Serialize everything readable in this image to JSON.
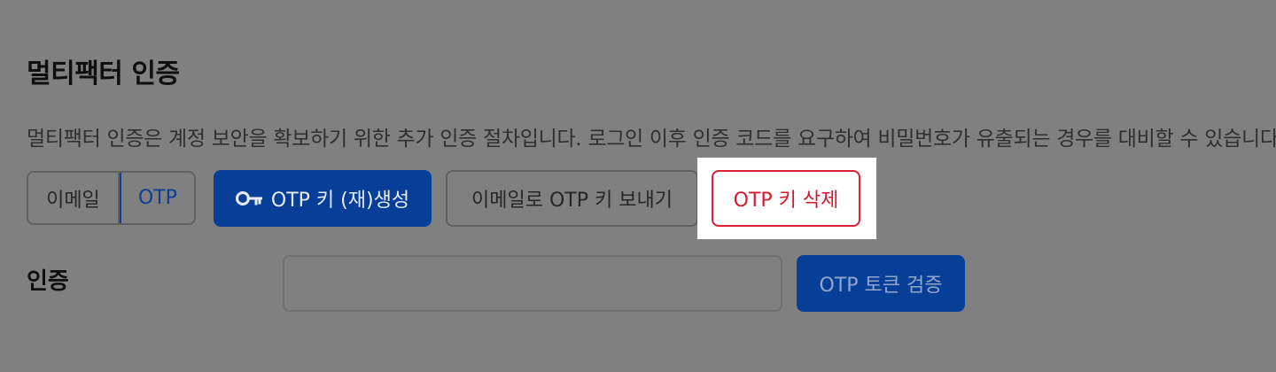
{
  "section": {
    "title": "멀티팩터 인증",
    "description": "멀티팩터 인증은 계정 보안을 확보하기 위한 추가 인증 절차입니다. 로그인 이후 인증 코드를 요구하여 비밀번호가 유출되는 경우를 대비할 수 있습니다."
  },
  "method_toggle": {
    "email_label": "이메일",
    "otp_label": "OTP",
    "selected": "OTP"
  },
  "actions": {
    "regenerate_label": "OTP 키 (재)생성",
    "regenerate_icon": "key-icon",
    "send_email_label": "이메일로 OTP 키 보내기",
    "delete_label": "OTP 키 삭제"
  },
  "verification": {
    "label": "인증",
    "input_value": "",
    "input_placeholder": "",
    "verify_label": "OTP 토큰 검증"
  },
  "colors": {
    "overlay": "#808080",
    "primary": "#073f98",
    "danger": "#dc1f35",
    "highlight": "#ffffff"
  }
}
